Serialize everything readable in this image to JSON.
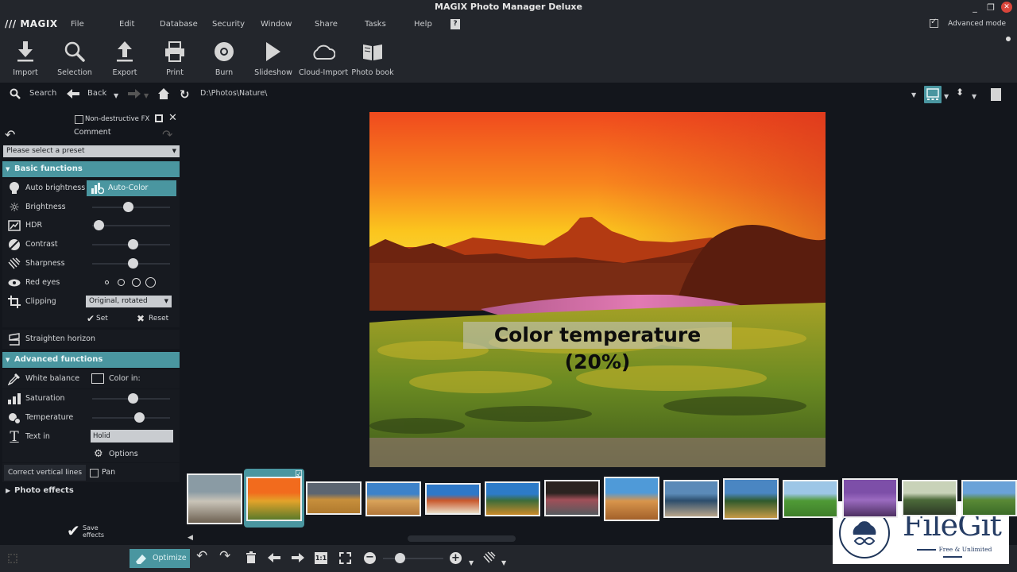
{
  "window": {
    "title": "MAGIX Photo Manager Deluxe",
    "controls": [
      "minimize",
      "restore",
      "close"
    ]
  },
  "menubar": {
    "logo": "/// MAGIX",
    "items": [
      "File",
      "Edit",
      "Database",
      "Security",
      "Window",
      "Share",
      "Tasks",
      "Help"
    ],
    "help_icon": "?",
    "advanced_mode": {
      "label": "Advanced mode",
      "checked": true
    }
  },
  "toolbar": {
    "buttons": [
      {
        "label": "Import",
        "icon": "download-icon"
      },
      {
        "label": "Selection",
        "icon": "search-icon"
      },
      {
        "label": "Export",
        "icon": "upload-icon"
      },
      {
        "label": "Print",
        "icon": "printer-icon"
      },
      {
        "label": "Burn",
        "icon": "disc-icon"
      },
      {
        "label": "Slideshow",
        "icon": "play-icon"
      },
      {
        "label": "Cloud-Import",
        "icon": "cloud-icon"
      },
      {
        "label": "Photo book",
        "icon": "book-icon"
      }
    ]
  },
  "navbar": {
    "search_label": "Search",
    "back_label": "Back",
    "path": "D:\\Photos\\Nature\\"
  },
  "left_panel": {
    "non_destructive_fx": {
      "label": "Non-destructive FX",
      "checked": false
    },
    "comment_label": "Comment",
    "preset_placeholder": "Please select a preset",
    "basic": {
      "title": "Basic functions",
      "auto_brightness": "Auto brightness",
      "auto_color": "Auto-Color",
      "brightness": {
        "label": "Brightness",
        "value": 0.46
      },
      "hdr": {
        "label": "HDR",
        "value": 0.08
      },
      "contrast": {
        "label": "Contrast",
        "value": 0.52
      },
      "sharpness": {
        "label": "Sharpness",
        "value": 0.52
      },
      "red_eyes": {
        "label": "Red eyes",
        "sizes": 4
      },
      "clipping": {
        "label": "Clipping",
        "option": "Original, rotated"
      },
      "set_label": "Set",
      "reset_label": "Reset",
      "straighten": "Straighten horizon"
    },
    "advanced": {
      "title": "Advanced functions",
      "white_balance": "White balance",
      "color_in": "Color in:",
      "saturation": {
        "label": "Saturation",
        "value": 0.52
      },
      "temperature": {
        "label": "Temperature",
        "value": 0.6
      },
      "text_in": {
        "label": "Text in",
        "value": "Holid"
      },
      "options": "Options",
      "correct_vertical": "Correct vertical lines",
      "pan": {
        "label": "Pan",
        "checked": false
      }
    },
    "photo_effects": "Photo effects",
    "save_effects": "Save effects"
  },
  "preview": {
    "caption": "Color temperature (20%)"
  },
  "filmstrip": {
    "thumbnails": [
      {
        "name": "rocky-shore",
        "colors": [
          "#8a9ba4",
          "#c9c4b8",
          "#6e6253"
        ]
      },
      {
        "name": "sunset-vineyard",
        "colors": [
          "#f26b1d",
          "#e3a32a",
          "#5b7a2a"
        ],
        "selected": true
      },
      {
        "name": "stormy-grassland",
        "colors": [
          "#5b6571",
          "#c78f3c",
          "#b07a2e"
        ]
      },
      {
        "name": "desert-canyon",
        "colors": [
          "#3d82c9",
          "#d9a35a",
          "#b2773a"
        ]
      },
      {
        "name": "red-dunes-tree",
        "colors": [
          "#2e78c8",
          "#c9572a",
          "#e8dcc6"
        ]
      },
      {
        "name": "tuscany-field",
        "colors": [
          "#2d7bc8",
          "#3c6c3a",
          "#c98a2a"
        ]
      },
      {
        "name": "bridge-lights",
        "colors": [
          "#2b2320",
          "#a04f58",
          "#555a5e"
        ]
      },
      {
        "name": "sand-dune",
        "colors": [
          "#4f9ad8",
          "#d8954c",
          "#a3612a"
        ]
      },
      {
        "name": "lake-pier",
        "colors": [
          "#5b8ab8",
          "#2c4d6c",
          "#b9a58a"
        ]
      },
      {
        "name": "lone-tree",
        "colors": [
          "#4a86c2",
          "#2f5a2c",
          "#c79a46"
        ]
      },
      {
        "name": "green-meadow",
        "colors": [
          "#9dc6e6",
          "#4f9a36",
          "#3f7f2a"
        ]
      },
      {
        "name": "purple-blossom",
        "colors": [
          "#7d4fa8",
          "#9b6bc0",
          "#4d3062"
        ]
      },
      {
        "name": "forest-trees",
        "colors": [
          "#c8d2b8",
          "#4c6a3a",
          "#2d3a26"
        ]
      },
      {
        "name": "tree-field",
        "colors": [
          "#6aa2d8",
          "#5a8a36",
          "#3b6b28"
        ]
      }
    ]
  },
  "bottombar": {
    "optimize_label": "Optimize",
    "one_to_one": "1:1",
    "zoom_value": 0.28
  },
  "watermark": {
    "brand": "FileGit",
    "tagline": "Free & Unlimited"
  }
}
